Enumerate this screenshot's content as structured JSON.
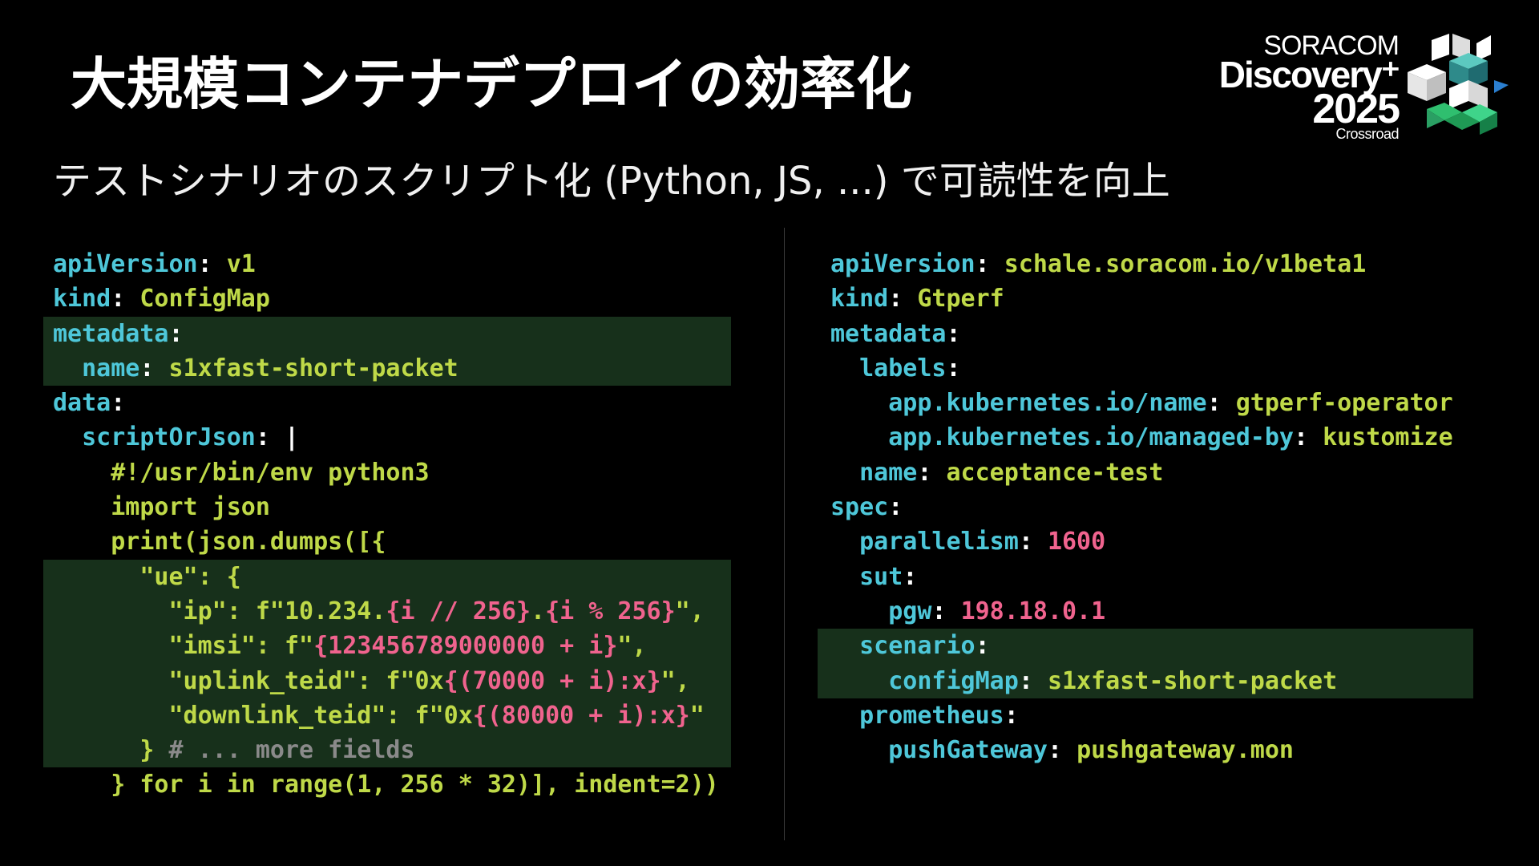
{
  "slide": {
    "title": "大規模コンテナデプロイの効率化",
    "subtitle": "テストシナリオのスクリプト化 (Python, JS, ...) で可読性を向上"
  },
  "logo": {
    "line1": "SORACOM",
    "line2": "Discovery⁺",
    "line3": "2025",
    "line4": "Crossroad",
    "mark_icon": "soracom-crossroad-logo-icon"
  },
  "colors": {
    "key": "#4ec7d9",
    "value": "#bfd948",
    "number": "#f0638e",
    "punctuation": "#ffffff",
    "comment": "#8a8a8a",
    "highlight": "#17301b",
    "background": "#000000"
  },
  "left_code": {
    "l1_key": "apiVersion",
    "l1_colon": ": ",
    "l1_val": "v1",
    "l2_key": "kind",
    "l2_colon": ": ",
    "l2_val": "ConfigMap",
    "l3_key": "metadata",
    "l3_colon": ":",
    "l4_indent": "  ",
    "l4_key": "name",
    "l4_colon": ": ",
    "l4_val": "s1xfast-short-packet",
    "l5_key": "data",
    "l5_colon": ":",
    "l6_indent": "  ",
    "l6_key": "scriptOrJson",
    "l6_colon": ": ",
    "l6_pipe": "|",
    "l7": "    #!/usr/bin/env python3",
    "l8": "    import json",
    "l9": "    print(json.dumps([{",
    "l10": "      \"ue\": {",
    "l11_a": "        \"ip\": f\"10.234.",
    "l11_b": "{i // 256}",
    "l11_c": ".",
    "l11_d": "{i % 256}",
    "l11_e": "\",",
    "l12_a": "        \"imsi\": f\"",
    "l12_b": "{123456789000000 + i}",
    "l12_c": "\",",
    "l13_a": "        \"uplink_teid\": f\"0x",
    "l13_b": "{(70000 + i):x}",
    "l13_c": "\",",
    "l14_a": "        \"downlink_teid\": f\"0x",
    "l14_b": "{(80000 + i):x}",
    "l14_c": "\"",
    "l15_a": "      } ",
    "l15_b": "# ... more fields",
    "l16": "    } for i in range(1, 256 * 32)], indent=2))"
  },
  "right_code": {
    "r1_key": "apiVersion",
    "r1_colon": ": ",
    "r1_val": "schale.soracom.io/v1beta1",
    "r2_key": "kind",
    "r2_colon": ": ",
    "r2_val": "Gtperf",
    "r3_key": "metadata",
    "r3_colon": ":",
    "r4_indent": "  ",
    "r4_key": "labels",
    "r4_colon": ":",
    "r5_indent": "    ",
    "r5_key": "app.kubernetes.io/name",
    "r5_colon": ": ",
    "r5_val": "gtperf-operator",
    "r6_indent": "    ",
    "r6_key": "app.kubernetes.io/managed-by",
    "r6_colon": ": ",
    "r6_val": "kustomize",
    "r7_indent": "  ",
    "r7_key": "name",
    "r7_colon": ": ",
    "r7_val": "acceptance-test",
    "r8_key": "spec",
    "r8_colon": ":",
    "r9_indent": "  ",
    "r9_key": "parallelism",
    "r9_colon": ": ",
    "r9_val": "1600",
    "r10_indent": "  ",
    "r10_key": "sut",
    "r10_colon": ":",
    "r11_indent": "    ",
    "r11_key": "pgw",
    "r11_colon": ": ",
    "r11_val": "198.18.0.1",
    "r12_indent": "  ",
    "r12_key": "scenario",
    "r12_colon": ":",
    "r13_indent": "    ",
    "r13_key": "configMap",
    "r13_colon": ": ",
    "r13_val": "s1xfast-short-packet",
    "r14_indent": "  ",
    "r14_key": "prometheus",
    "r14_colon": ":",
    "r15_indent": "    ",
    "r15_key": "pushGateway",
    "r15_colon": ": ",
    "r15_val": "pushgateway.mon"
  }
}
